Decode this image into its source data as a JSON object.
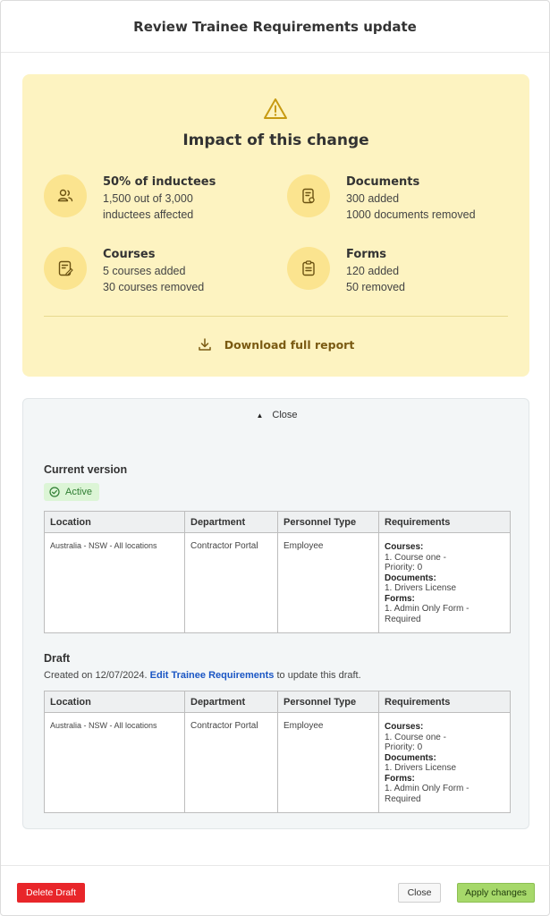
{
  "modal": {
    "title": "Review Trainee Requirements update"
  },
  "impact": {
    "title": "Impact of this change",
    "stats": [
      {
        "title": "50% of inductees",
        "line1": "1,500 out of 3,000",
        "line2": "inductees affected",
        "icon": "users-icon"
      },
      {
        "title": "Documents",
        "line1": "300 added",
        "line2": "1000 documents removed",
        "icon": "document-icon"
      },
      {
        "title": "Courses",
        "line1": "5 courses added",
        "line2": "30 courses removed",
        "icon": "course-icon"
      },
      {
        "title": "Forms",
        "line1": "120 added",
        "line2": "50 removed",
        "icon": "form-icon"
      }
    ],
    "download_label": "Download full report"
  },
  "versions": {
    "toggle_label": "Close",
    "current": {
      "title": "Current version",
      "badge": "Active",
      "headers": [
        "Location",
        "Department",
        "Personnel Type",
        "Requirements"
      ],
      "row": {
        "location": "Australia - NSW - All locations",
        "department": "Contractor Portal",
        "personnel": "Employee",
        "req_courses_label": "Courses:",
        "req_course_1": "1. Course one -",
        "req_course_1b": "Priority: 0",
        "req_documents_label": "Documents:",
        "req_document_1": "1. Drivers License",
        "req_forms_label": "Forms:",
        "req_form_1": "1. Admin Only Form -",
        "req_form_1b": "Required"
      }
    },
    "draft": {
      "title": "Draft",
      "note_prefix": "Created on 12/07/2024.",
      "note_link": "Edit Trainee Requirements",
      "note_suffix": "to update this draft.",
      "headers": [
        "Location",
        "Department",
        "Personnel Type",
        "Requirements"
      ],
      "row": {
        "location": "Australia - NSW - All locations",
        "department": "Contractor Portal",
        "personnel": "Employee",
        "req_courses_label": "Courses:",
        "req_course_1": "1. Course one -",
        "req_course_1b": "Priority: 0",
        "req_documents_label": "Documents:",
        "req_document_1": "1. Drivers License",
        "req_forms_label": "Forms:",
        "req_form_1": "1. Admin Only Form -",
        "req_form_1b": "Required"
      }
    }
  },
  "footer": {
    "delete_label": "Delete Draft",
    "close_label": "Close",
    "apply_label": "Apply changes"
  },
  "colors": {
    "impact_bg": "#fdf3c1",
    "icon_circle": "#fbe48f",
    "accent_brown": "#7a5a12",
    "danger": "#e8262a",
    "success": "#a6d86a",
    "link": "#1a56c4"
  }
}
